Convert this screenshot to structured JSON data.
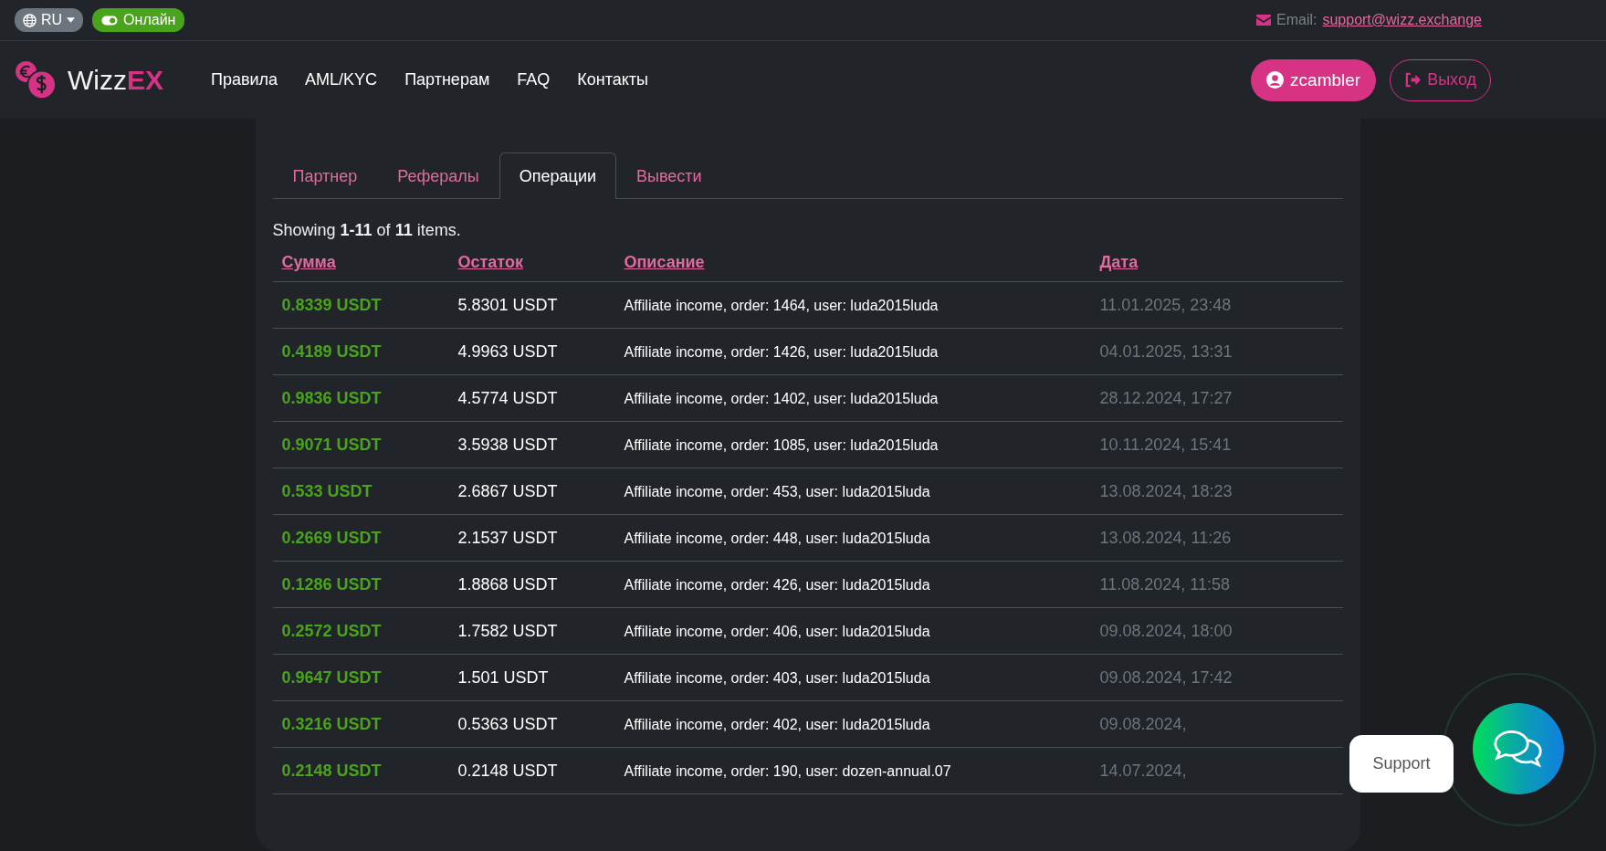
{
  "top_bar": {
    "language": "RU",
    "status": {
      "label": "Онлайн",
      "on": true
    },
    "email_label": "Email:",
    "email": "support@wizz.exchange"
  },
  "header": {
    "logo": {
      "light": "Wizz",
      "bold": "EX"
    },
    "nav": [
      "Правила",
      "AML/KYC",
      "Партнерам",
      "FAQ",
      "Контакты"
    ],
    "user_button": "zcambler",
    "logout_button": "Выход"
  },
  "tabs": [
    {
      "label": "Партнер",
      "selected": false
    },
    {
      "label": "Рефералы",
      "selected": false
    },
    {
      "label": "Операции",
      "selected": true
    },
    {
      "label": "Вывести",
      "selected": false
    }
  ],
  "summary": "Showing **1-11** of **11** items.",
  "table": {
    "columns": [
      "Сумма",
      "Остаток",
      "Описание",
      "Дата"
    ],
    "rows": [
      {
        "amount": "0.8339 USDT",
        "balance": "5.8301 USDT",
        "description": "Affiliate income, order: 1464, user: luda2015luda",
        "date": "11.01.2025, 23:48"
      },
      {
        "amount": "0.4189 USDT",
        "balance": "4.9963 USDT",
        "description": "Affiliate income, order: 1426, user: luda2015luda",
        "date": "04.01.2025, 13:31"
      },
      {
        "amount": "0.9836 USDT",
        "balance": "4.5774 USDT",
        "description": "Affiliate income, order: 1402, user: luda2015luda",
        "date": "28.12.2024, 17:27"
      },
      {
        "amount": "0.9071 USDT",
        "balance": "3.5938 USDT",
        "description": "Affiliate income, order: 1085, user: luda2015luda",
        "date": "10.11.2024, 15:41"
      },
      {
        "amount": "0.533 USDT",
        "balance": "2.6867 USDT",
        "description": "Affiliate income, order: 453, user: luda2015luda",
        "date": "13.08.2024, 18:23"
      },
      {
        "amount": "0.2669 USDT",
        "balance": "2.1537 USDT",
        "description": "Affiliate income, order: 448, user: luda2015luda",
        "date": "13.08.2024, 11:26"
      },
      {
        "amount": "0.1286 USDT",
        "balance": "1.8868 USDT",
        "description": "Affiliate income, order: 426, user: luda2015luda",
        "date": "11.08.2024, 11:58"
      },
      {
        "amount": "0.2572 USDT",
        "balance": "1.7582 USDT",
        "description": "Affiliate income, order: 406, user: luda2015luda",
        "date": "09.08.2024, 18:00"
      },
      {
        "amount": "0.9647 USDT",
        "balance": "1.501 USDT",
        "description": "Affiliate income, order: 403, user: luda2015luda",
        "date": "09.08.2024, 17:42"
      },
      {
        "amount": "0.3216 USDT",
        "balance": "0.5363 USDT",
        "description": "Affiliate income, order: 402, user: luda2015luda",
        "date": "09.08.2024,"
      },
      {
        "amount": "0.2148 USDT",
        "balance": "0.2148 USDT",
        "description": "Affiliate income, order: 190, user: dozen-annual.07",
        "date": "14.07.2024,"
      }
    ]
  },
  "support_widget": {
    "label": "Support"
  }
}
